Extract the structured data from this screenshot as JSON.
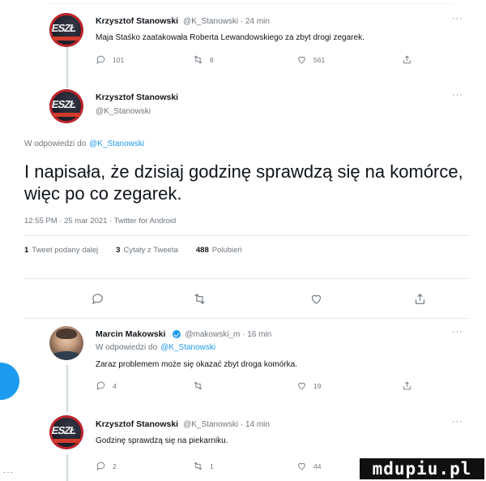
{
  "tweet1": {
    "name": "Krzysztof Stanowski",
    "handle_time": "@K_Stanowski · 24 min",
    "text": "Maja Staśko zaatakowała Roberta Lewandowskiego za zbyt drogi zegarek.",
    "replies": "101",
    "retweets": "8",
    "likes": "561",
    "more": "···"
  },
  "main_tweet": {
    "name": "Krzysztof Stanowski",
    "handle": "@K_Stanowski",
    "reply_prefix": "W odpowiedzi do",
    "reply_to": "@K_Stanowski",
    "text": "I napisała, że dzisiaj godzinę sprawdzą się na komórce, więc po co zegarek.",
    "meta": "12:55 PM · 25 mar 2021 · Twitter for Android",
    "stats": [
      {
        "count": "1",
        "label": "Tweet podany dalej"
      },
      {
        "count": "3",
        "label": "Cytaty z Tweeta"
      },
      {
        "count": "488",
        "label": "Polubień"
      }
    ],
    "more": "···"
  },
  "reply1": {
    "name": "Marcin Makowski",
    "handle_time": "@makowski_m · 16 min",
    "reply_prefix": "W odpowiedzi do",
    "reply_to": "@K_Stanowski",
    "text": "Zaraz problemem może się okazać zbyt droga komórka.",
    "replies": "4",
    "retweets": "",
    "likes": "19",
    "more": "···"
  },
  "reply2": {
    "name": "Krzysztof Stanowski",
    "handle_time": "@K_Stanowski · 14 min",
    "text": "Godzinę sprawdzą się na piekarniku.",
    "replies": "2",
    "retweets": "1",
    "likes": "44",
    "more": "···"
  },
  "sidebar": {
    "more": "···"
  },
  "watermark": "mdupiu.pl",
  "colors": {
    "accent": "#1d9bf0",
    "muted": "#6e767d",
    "text": "#0f1419"
  }
}
